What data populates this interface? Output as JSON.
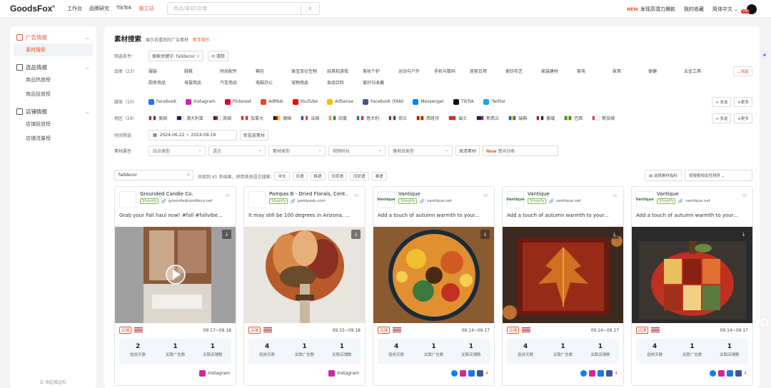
{
  "header": {
    "logo": "GoodsFox",
    "nav": [
      "工作台",
      "品牌研究",
      "TikTok",
      "独立站"
    ],
    "active_nav": "独立站",
    "search_placeholder": "商品/素材/店铺",
    "new_tag": "NEW",
    "discover": "发现高潜力爆款",
    "favorites": "我的收藏",
    "language": "简体中文",
    "vip": "VIP"
  },
  "sidebar": {
    "groups": [
      {
        "label": "广告情报",
        "items": [
          "素材搜索"
        ]
      },
      {
        "label": "选品情报",
        "items": [
          "商品热度榜",
          "商品投放榜"
        ]
      },
      {
        "label": "店铺情报",
        "items": [
          "店铺投放榜",
          "店铺流量榜"
        ]
      }
    ],
    "active_item": "素材搜索",
    "collapse": "收起推边栏"
  },
  "page": {
    "title": "素材搜索",
    "subtitle": "展示去重后的广告素材",
    "guide": "新手指引"
  },
  "filters": {
    "conditions_label": "筛选条件：",
    "condition_chip": "搜索关键字: falldecor",
    "clear": "清除",
    "category_label": "品类（23）",
    "categories": [
      "服装",
      "鞋靴",
      "时尚配件",
      "箱包",
      "珠宝及衍生物",
      "玩具和游戏",
      "美妆个护",
      "运动与户外",
      "手机与数码",
      "居家日用",
      "家纺布艺",
      "家装建材",
      "家电",
      "家具",
      "保健",
      "五金工具",
      "厨房用品",
      "母婴用品",
      "汽车用品",
      "电脑办公",
      "宠物用品",
      "食品饮料",
      "爱好与收藏"
    ],
    "collapse_btn": "收起",
    "media_label": "媒体（10）",
    "media": [
      {
        "name": "Facebook",
        "color": "#1877f2"
      },
      {
        "name": "Instagram",
        "color": "#d6249f"
      },
      {
        "name": "Pinterest",
        "color": "#e60023"
      },
      {
        "name": "AdMob",
        "color": "#ea4335"
      },
      {
        "name": "YouTube",
        "color": "#ff0000"
      },
      {
        "name": "AdSense",
        "color": "#fbbc04"
      },
      {
        "name": "Facebook (FAN)",
        "color": "#3b5998"
      },
      {
        "name": "Messenger",
        "color": "#0084ff"
      },
      {
        "name": "TikTok",
        "color": "#111111"
      },
      {
        "name": "Twitter",
        "color": "#1da1f2"
      }
    ],
    "multi": "+ 多选",
    "more": "更多",
    "region_label": "地区（29）",
    "regions": [
      "美国",
      "澳大利亚",
      "英国",
      "加拿大",
      "德国",
      "法国",
      "印度",
      "意大利",
      "荷兰",
      "西班牙",
      "瑞士",
      "新西兰",
      "瑞典",
      "挪威",
      "巴西",
      "新加坡"
    ],
    "time_label": "时间筛选",
    "date_range": "2024-06-22 ~ 2024-09-19",
    "new_material": "新投放素材",
    "attr_label": "素材属性",
    "selects": [
      "站点类型",
      "语言",
      "素材类型",
      "视频时长",
      "落地页类型"
    ],
    "hd": "高清素材",
    "new_label": "New",
    "audience": "受众分析"
  },
  "results": {
    "keyword": "falldecor",
    "found": "共找到 41 条结果，使用其他语言搜索:",
    "langs": [
      "中文",
      "日语",
      "韩语",
      "印尼语",
      "印尼语",
      "泰语"
    ],
    "select_metric": "选择素材指标",
    "sort": "按搜索相关性排序"
  },
  "cards": [
    {
      "store": "Grounded Candle Co.",
      "platform": "Shopify",
      "site": "groundedcandleco.net",
      "text": "Grab your Fall haul now! #fall #fallvibe...",
      "tag": "店铺",
      "date": "09.17~09.18",
      "days": "2",
      "ads": "1",
      "shops": "1",
      "foot": "Instagram",
      "img": "candle"
    },
    {
      "store": "Pampas B - Dried Florals, Cent...",
      "platform": "Shopify",
      "site": "pampasb.com",
      "text": "It may still be 100 degrees in Arizona, ...",
      "tag": "店铺",
      "date": "09.15~09.18",
      "days": "4",
      "ads": "1",
      "shops": "1",
      "foot": "Instagram",
      "img": "floral"
    },
    {
      "store": "Vantique",
      "platform": "Shopify",
      "site": "vantique.net",
      "text": "Add a touch of autumn warmth to your...",
      "tag": "店铺",
      "date": "09.14~09.17",
      "days": "4",
      "ads": "1",
      "shops": "1",
      "foot": "4",
      "img": "mat"
    },
    {
      "store": "Vantique",
      "platform": "Shopify",
      "site": "vantique.net",
      "text": "Add a touch of autumn warmth to your...",
      "tag": "店铺",
      "date": "09.14~09.17",
      "days": "4",
      "ads": "1",
      "shops": "1",
      "foot": "4",
      "img": "pillow"
    },
    {
      "store": "Vantique",
      "platform": "Shopify",
      "site": "vantique.net",
      "text": "Add a touch of autumn warmth to your...",
      "tag": "店铺",
      "date": "09.14~09.17",
      "days": "4",
      "ads": "1",
      "shops": "1",
      "foot": "4",
      "img": "pumpkin"
    }
  ],
  "stat_labels": [
    "投放天数",
    "关联广告数",
    "关联店铺数"
  ]
}
